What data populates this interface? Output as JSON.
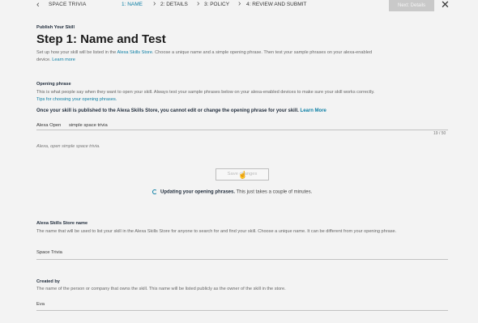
{
  "header": {
    "back_glyph": "‹",
    "app_name": "SPACE TRIVIA",
    "steps": [
      {
        "label": "1: NAME",
        "active": true
      },
      {
        "label": "2: DETAILS",
        "active": false
      },
      {
        "label": "3: POLICY",
        "active": false
      },
      {
        "label": "4: REVIEW AND SUBMIT",
        "active": false
      }
    ],
    "next_button": "Next: Details",
    "close_glyph": "✕"
  },
  "page": {
    "section_label": "Publish Your Skill",
    "title": "Step 1: Name and Test",
    "intro_text": "Set up how your skill will be listed in the ",
    "intro_link": "Alexa Skills Store",
    "intro_text2": ". Choose a unique name and a simple opening phrase. Then test your sample phrases on your alexa-enabled",
    "intro_text3": "device. ",
    "intro_learn_more": "Learn more"
  },
  "opening_phrase": {
    "label": "Opening phrase",
    "desc": "This is what people say when they want to open your skill. Always test your sample phrases below on your alexa-enabled devices to make sure your skill works correctly.",
    "tips_link": "Tips for choosing your opening phrases.",
    "note": "Once your skill is published to the Alexa Skills Store, you cannot edit or change the opening phrase for your skill.",
    "note_link": "Learn More",
    "prefix": "Alexa Open",
    "value": "simple space trivia",
    "counter": "19 / 50",
    "hint": "Alexa, open simple space trivia.",
    "save_button": "Save changes",
    "status_strong": "Updating your opening phrases.",
    "status_rest": " This just takes a couple of minutes."
  },
  "store_name": {
    "label": "Alexa Skills Store name",
    "desc": "The name that will be used to list your skill in the Alexa Skills Store for anyone to search for and find your skill. Choose a unique name. It can be different from your opening phrase.",
    "value": "Space Trivia"
  },
  "created_by": {
    "label": "Created by",
    "desc": "The name of the person or company that owns the skill. This name will be listed publicly as the owner of the skill in the store.",
    "value": "Eva"
  }
}
